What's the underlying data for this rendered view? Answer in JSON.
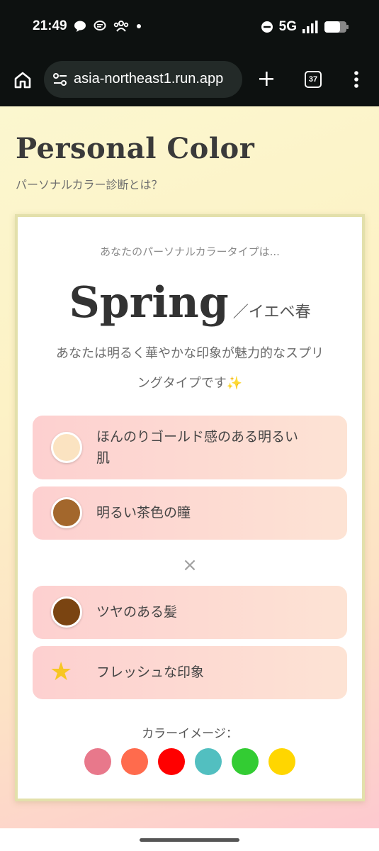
{
  "status_bar": {
    "time": "21:49",
    "network": "5G",
    "left_icons": [
      "chat-bubble-icon",
      "message-icon",
      "group-icon",
      "dot-icon"
    ],
    "right_icons": [
      "do-not-disturb-icon",
      "signal-icon",
      "battery-icon"
    ]
  },
  "browser": {
    "url": "asia-northeast1.run.app",
    "tab_count": "37"
  },
  "page": {
    "title": "Personal Color",
    "subtitle": "パーソナルカラー診断とは？"
  },
  "result": {
    "lead": "あなたのパーソナルカラータイプは...",
    "name": "Spring",
    "sub": "／イエベ春",
    "desc_line1": "あなたは明るく華やかな印象が魅力的なスプリ",
    "desc_line2": "ングタイプです✨"
  },
  "traits": [
    {
      "label_line1": "ほんのりゴールド感のある明るい",
      "label_line2": "肌",
      "color": "#fbe3c1"
    },
    {
      "label": "明るい茶色の瞳",
      "color": "#a3672c"
    },
    {
      "label": "ツヤのある髪",
      "color": "#7a4411"
    },
    {
      "label": "フレッシュな印象",
      "icon": "star-icon"
    }
  ],
  "separator": "×",
  "palette": {
    "title": "カラーイメージ：",
    "colors": [
      "#e8788b",
      "#ff6b4d",
      "#ff0000",
      "#52bfc0",
      "#33cc33",
      "#ffd600"
    ]
  }
}
